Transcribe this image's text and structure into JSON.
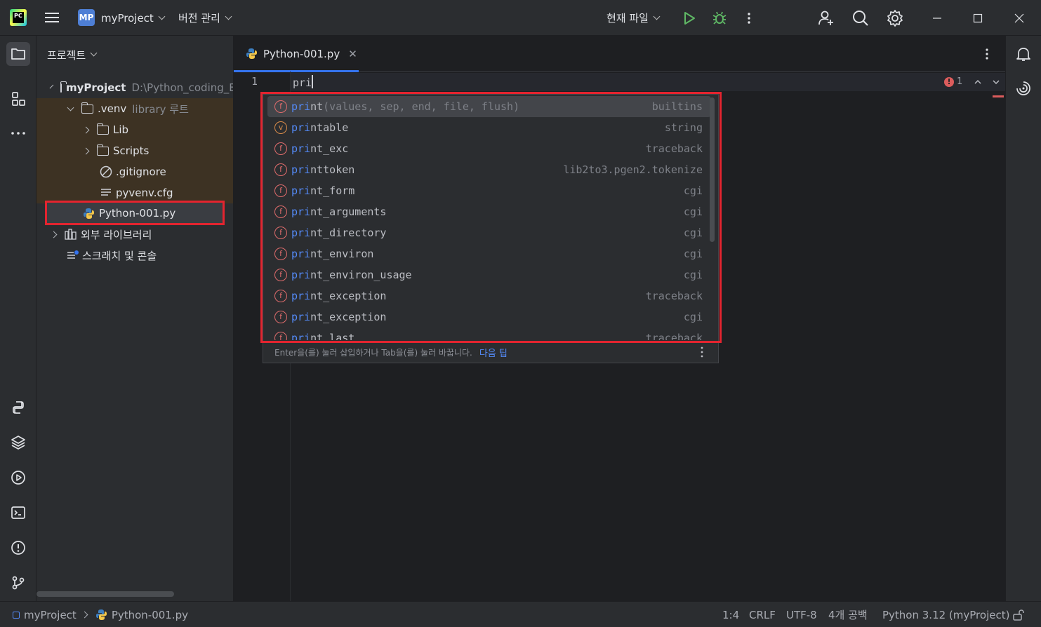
{
  "titlebar": {
    "logo_text": "PC",
    "project_badge": "MP",
    "project_name": "myProject",
    "vcs_menu": "버전 관리",
    "run_config": "현재 파일"
  },
  "project_panel": {
    "header": "프로젝트",
    "root": {
      "name": "myProject",
      "path": "D:\\Python_coding_E"
    },
    "venv": {
      "name": ".venv",
      "hint": "library 루트"
    },
    "items": [
      {
        "label": "Lib"
      },
      {
        "label": "Scripts"
      },
      {
        "label": ".gitignore"
      },
      {
        "label": "pyvenv.cfg"
      }
    ],
    "selected_file": "Python-001.py",
    "external_libs": "외부 라이브러리",
    "scratches": "스크래치 및 콘솔"
  },
  "editor": {
    "tab_label": "Python-001.py",
    "line_number": "1",
    "code_text": "pri",
    "error_count": "1"
  },
  "completion": {
    "typed": "pri",
    "items": [
      {
        "kind": "f",
        "match": "pri",
        "rest": "nt",
        "params": "(values, sep, end, file, flush)",
        "source": "builtins"
      },
      {
        "kind": "v",
        "match": "pri",
        "rest": "ntable",
        "params": "",
        "source": "string"
      },
      {
        "kind": "f",
        "match": "pri",
        "rest": "nt_exc",
        "params": "",
        "source": "traceback"
      },
      {
        "kind": "f",
        "match": "pri",
        "rest": "nttoken",
        "params": "",
        "source": "lib2to3.pgen2.tokenize"
      },
      {
        "kind": "f",
        "match": "pri",
        "rest": "nt_form",
        "params": "",
        "source": "cgi"
      },
      {
        "kind": "f",
        "match": "pri",
        "rest": "nt_arguments",
        "params": "",
        "source": "cgi"
      },
      {
        "kind": "f",
        "match": "pri",
        "rest": "nt_directory",
        "params": "",
        "source": "cgi"
      },
      {
        "kind": "f",
        "match": "pri",
        "rest": "nt_environ",
        "params": "",
        "source": "cgi"
      },
      {
        "kind": "f",
        "match": "pri",
        "rest": "nt_environ_usage",
        "params": "",
        "source": "cgi"
      },
      {
        "kind": "f",
        "match": "pri",
        "rest": "nt_exception",
        "params": "",
        "source": "traceback"
      },
      {
        "kind": "f",
        "match": "pri",
        "rest": "nt_exception",
        "params": "",
        "source": "cgi"
      },
      {
        "kind": "f",
        "match": "pri",
        "rest": "nt_last",
        "params": "",
        "source": "traceback"
      }
    ],
    "footer_hint": "Enter을(를) 눌러 삽입하거나 Tab을(를) 눌러 바꿉니다.",
    "footer_tip": "다음 팁"
  },
  "statusbar": {
    "project": "myProject",
    "file": "Python-001.py",
    "position": "1:4",
    "line_sep": "CRLF",
    "encoding": "UTF-8",
    "indent": "4개 공백",
    "interpreter": "Python 3.12 (myProject)"
  },
  "colors": {
    "highlight_outline": "#e3242f",
    "match_blue": "#548af7",
    "accent": "#3574f0"
  }
}
